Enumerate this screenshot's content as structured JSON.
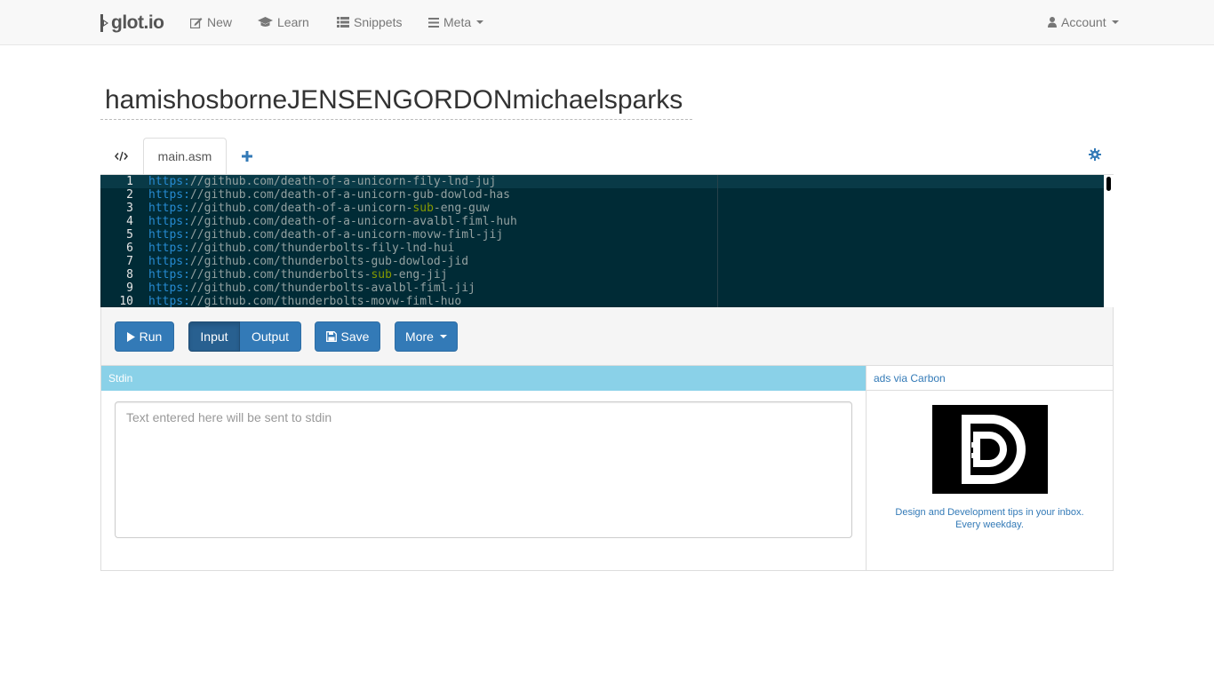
{
  "navbar": {
    "brand": "glot.io",
    "items": [
      {
        "label": "New",
        "icon": "edit-icon"
      },
      {
        "label": "Learn",
        "icon": "graduation-cap-icon"
      },
      {
        "label": "Snippets",
        "icon": "list-icon"
      },
      {
        "label": "Meta",
        "icon": "bars-icon"
      }
    ],
    "account": "Account"
  },
  "snippet": {
    "title": "hamishosborneJENSENGORDONmichaelsparks"
  },
  "tabs": {
    "file": "main.asm"
  },
  "editor": {
    "lines": [
      {
        "num": "1",
        "scheme": "https:",
        "before": "//github.com/death-of-a-unicorn-fily-lnd-juj",
        "hl": "",
        "after": ""
      },
      {
        "num": "2",
        "scheme": "https:",
        "before": "//github.com/death-of-a-unicorn-gub-dowlod-has",
        "hl": "",
        "after": ""
      },
      {
        "num": "3",
        "scheme": "https:",
        "before": "//github.com/death-of-a-unicorn-",
        "hl": "sub",
        "after": "-eng-guw"
      },
      {
        "num": "4",
        "scheme": "https:",
        "before": "//github.com/death-of-a-unicorn-avalbl-fiml-huh",
        "hl": "",
        "after": ""
      },
      {
        "num": "5",
        "scheme": "https:",
        "before": "//github.com/death-of-a-unicorn-movw-fiml-jij",
        "hl": "",
        "after": ""
      },
      {
        "num": "6",
        "scheme": "https:",
        "before": "//github.com/thunderbolts-fily-lnd-hui",
        "hl": "",
        "after": ""
      },
      {
        "num": "7",
        "scheme": "https:",
        "before": "//github.com/thunderbolts-gub-dowlod-jid",
        "hl": "",
        "after": ""
      },
      {
        "num": "8",
        "scheme": "https:",
        "before": "//github.com/thunderbolts-",
        "hl": "sub",
        "after": "-eng-jij"
      },
      {
        "num": "9",
        "scheme": "https:",
        "before": "//github.com/thunderbolts-avalbl-fiml-jij",
        "hl": "",
        "after": ""
      },
      {
        "num": "10",
        "scheme": "https:",
        "before": "//github.com/thunderbolts-movw-fiml-huo",
        "hl": "",
        "after": ""
      }
    ]
  },
  "toolbar": {
    "run": "Run",
    "input": "Input",
    "output": "Output",
    "save": "Save",
    "more": "More"
  },
  "io": {
    "header": "Stdin",
    "placeholder": "Text entered here will be sent to stdin"
  },
  "ads": {
    "header": "ads via Carbon",
    "text": "Design and Development tips in your inbox. Every weekday."
  },
  "colors": {
    "primary": "#337ab7",
    "editor_bg": "#002b36",
    "stdin_header": "#8ad1e8"
  }
}
